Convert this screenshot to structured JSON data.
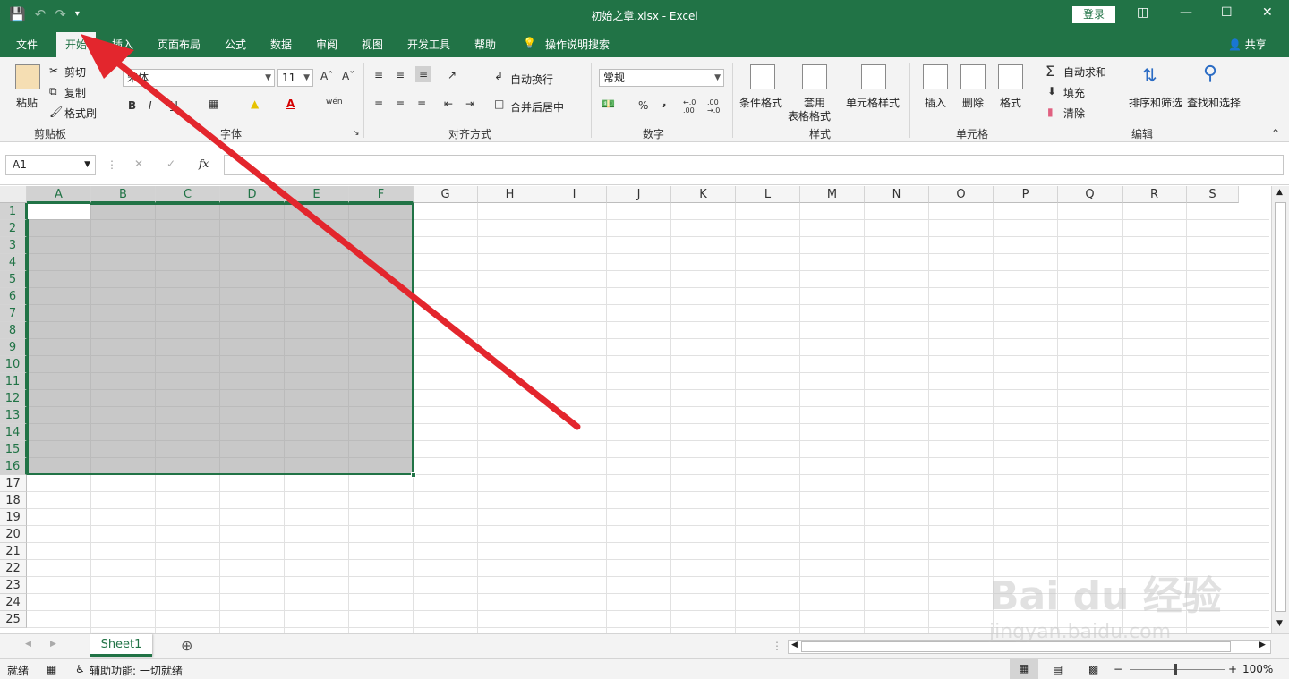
{
  "app": {
    "title": "初始之章.xlsx  -  Excel",
    "login_label": "登录",
    "share_label": "共享"
  },
  "tabs": [
    "文件",
    "开始",
    "插入",
    "页面布局",
    "公式",
    "数据",
    "审阅",
    "视图",
    "开发工具",
    "帮助"
  ],
  "tell_me": "操作说明搜索",
  "ribbon": {
    "clipboard": {
      "paste": "粘贴",
      "cut": "剪切",
      "copy": "复制",
      "format_painter": "格式刷",
      "label": "剪贴板"
    },
    "font": {
      "name": "宋体",
      "size": "11",
      "label": "字体",
      "bold": "B",
      "italic": "I",
      "underline": "U",
      "phonetic": "wén"
    },
    "alignment": {
      "wrap": "自动换行",
      "merge": "合并后居中",
      "label": "对齐方式"
    },
    "number": {
      "format": "常规",
      "label": "数字",
      "percent": "%",
      "comma": ",",
      "inc_dec": "←.0 .00",
      "dec_dec": ".00 →.0"
    },
    "styles": {
      "conditional": "条件格式",
      "table_1": "套用",
      "table_2": "表格格式",
      "cell_styles": "单元格样式",
      "label": "样式"
    },
    "cells": {
      "insert": "插入",
      "delete": "删除",
      "format": "格式",
      "label": "单元格"
    },
    "editing": {
      "autosum": "自动求和",
      "fill": "填充",
      "clear": "清除",
      "sort": "排序和筛选",
      "find": "查找和选择",
      "label": "编辑"
    }
  },
  "formula_bar": {
    "name_box": "A1",
    "fx": "fx",
    "cancel": "✕",
    "enter": "✓"
  },
  "grid": {
    "columns": [
      "A",
      "B",
      "C",
      "D",
      "E",
      "F",
      "G",
      "H",
      "I",
      "J",
      "K",
      "L",
      "M",
      "N",
      "O",
      "P",
      "Q",
      "R",
      "S"
    ],
    "rows": [
      "1",
      "2",
      "3",
      "4",
      "5",
      "6",
      "7",
      "8",
      "9",
      "10",
      "11",
      "12",
      "13",
      "14",
      "15",
      "16",
      "17",
      "18",
      "19",
      "20",
      "21",
      "22",
      "23",
      "24",
      "25"
    ],
    "selection": "A1:F16"
  },
  "sheets": [
    {
      "name": "Sheet1",
      "active": true
    }
  ],
  "status": {
    "ready": "就绪",
    "accessibility": "辅助功能: 一切就绪",
    "zoom": "100%"
  },
  "watermark": {
    "text1": "Bai du 经验",
    "text2": "jingyan.baidu.com"
  },
  "colors": {
    "excel_green": "#217346",
    "arrow_red": "#e3262d"
  }
}
